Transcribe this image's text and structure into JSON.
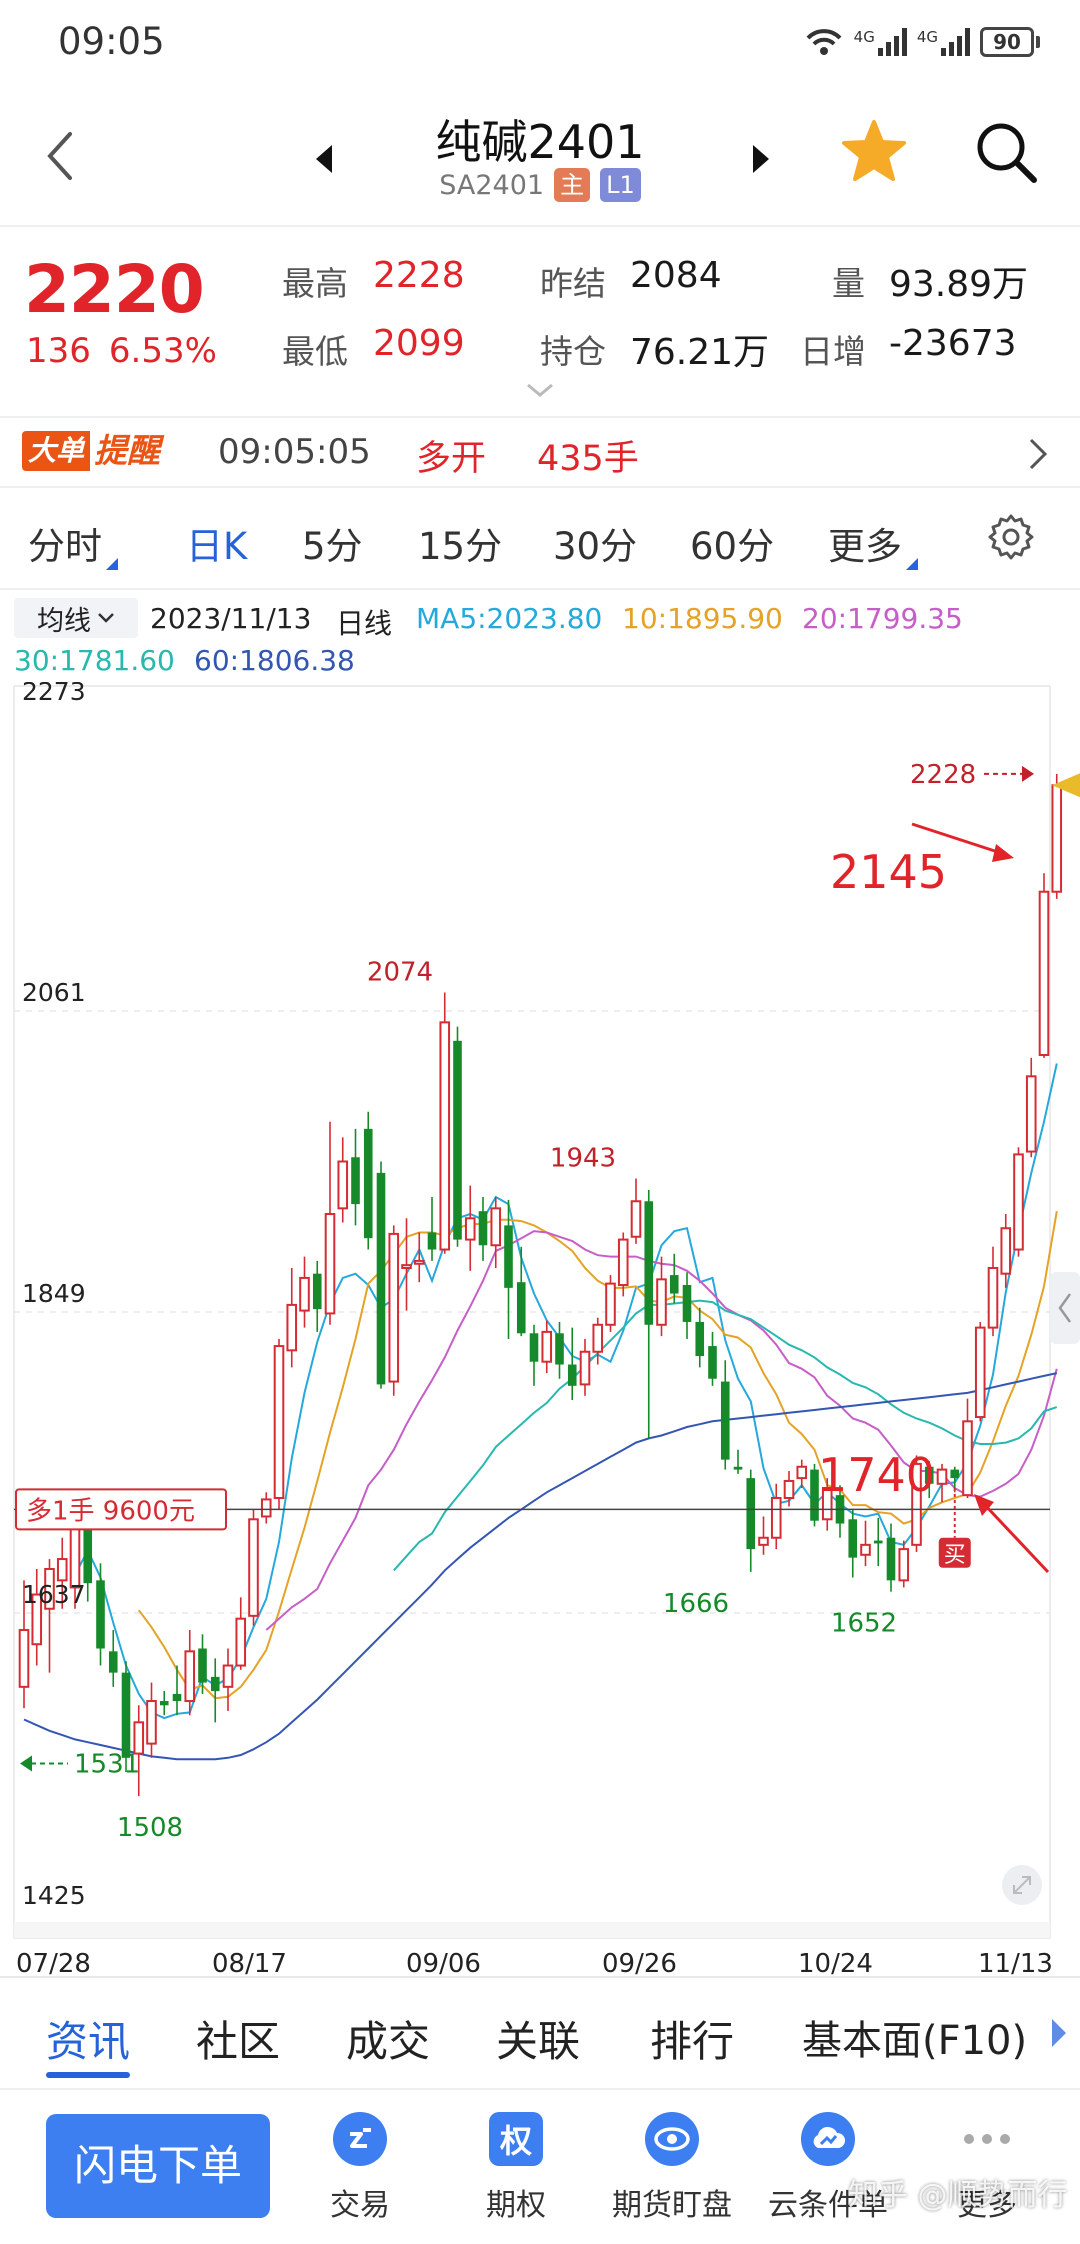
{
  "status_bar": {
    "time": "09:05",
    "net1": "4G",
    "net2": "4G",
    "battery": "90"
  },
  "header": {
    "title": "纯碱2401",
    "code": "SA2401",
    "tag_main": "主",
    "tag_level": "L1",
    "colors": {
      "tag_main": "#e27b56",
      "tag_level": "#7f8ad8",
      "star": "#f6ab28"
    }
  },
  "quote": {
    "last": "2220",
    "change": "136",
    "change_pct": "6.53%",
    "high_label": "最高",
    "high": "2228",
    "low_label": "最低",
    "low": "2099",
    "prev_settle_label": "昨结",
    "prev_settle": "2084",
    "oi_label": "持仓",
    "oi": "76.21万",
    "volume_label": "量",
    "volume": "93.89万",
    "daily_inc_label": "日增",
    "daily_inc": "-23673"
  },
  "alert": {
    "logo_a": "大单",
    "logo_b": "提醒",
    "time": "09:05:05",
    "type": "多开",
    "volume": "435手"
  },
  "period_tabs": [
    {
      "label": "分时",
      "active": false,
      "dropdown": true
    },
    {
      "label": "日K",
      "active": true,
      "dropdown": false
    },
    {
      "label": "5分",
      "active": false,
      "dropdown": false
    },
    {
      "label": "15分",
      "active": false,
      "dropdown": false
    },
    {
      "label": "30分",
      "active": false,
      "dropdown": false
    },
    {
      "label": "60分",
      "active": false,
      "dropdown": false
    },
    {
      "label": "更多",
      "active": false,
      "dropdown": true
    }
  ],
  "indicator": {
    "select": "均线",
    "date": "2023/11/13",
    "line_type": "日线",
    "ma": [
      {
        "text": "MA5:2023.80",
        "color": "#25a8dc"
      },
      {
        "text": "10:1895.90",
        "color": "#e5a227"
      },
      {
        "text": "20:1799.35",
        "color": "#c75ec8"
      },
      {
        "text": "30:1781.60",
        "color": "#28b8b0"
      },
      {
        "text": "60:1806.38",
        "color": "#3456b3"
      }
    ]
  },
  "chart_data": {
    "type": "candlestick",
    "y_ticks": [
      "2273",
      "2061",
      "1849",
      "1637",
      "1425"
    ],
    "ylim": [
      1425,
      2273
    ],
    "x_labels": [
      "07/28",
      "08/17",
      "09/06",
      "09/26",
      "10/24",
      "11/13"
    ],
    "candles": [
      {
        "o": 1585,
        "c": 1625,
        "h": 1660,
        "l": 1570
      },
      {
        "o": 1615,
        "c": 1650,
        "h": 1668,
        "l": 1600
      },
      {
        "o": 1640,
        "c": 1668,
        "h": 1675,
        "l": 1595
      },
      {
        "o": 1660,
        "c": 1675,
        "h": 1690,
        "l": 1640
      },
      {
        "o": 1655,
        "c": 1700,
        "h": 1712,
        "l": 1640
      },
      {
        "o": 1705,
        "c": 1658,
        "h": 1712,
        "l": 1645
      },
      {
        "o": 1660,
        "c": 1612,
        "h": 1672,
        "l": 1600
      },
      {
        "o": 1610,
        "c": 1595,
        "h": 1625,
        "l": 1585
      },
      {
        "o": 1595,
        "c": 1535,
        "h": 1603,
        "l": 1525
      },
      {
        "o": 1538,
        "c": 1560,
        "h": 1572,
        "l": 1508
      },
      {
        "o": 1545,
        "c": 1575,
        "h": 1588,
        "l": 1535
      },
      {
        "o": 1575,
        "c": 1572,
        "h": 1582,
        "l": 1565
      },
      {
        "o": 1580,
        "c": 1575,
        "h": 1600,
        "l": 1565
      },
      {
        "o": 1575,
        "c": 1610,
        "h": 1625,
        "l": 1565
      },
      {
        "o": 1612,
        "c": 1588,
        "h": 1622,
        "l": 1580
      },
      {
        "o": 1592,
        "c": 1582,
        "h": 1605,
        "l": 1560
      },
      {
        "o": 1585,
        "c": 1600,
        "h": 1612,
        "l": 1568
      },
      {
        "o": 1600,
        "c": 1633,
        "h": 1648,
        "l": 1597
      },
      {
        "o": 1635,
        "c": 1703,
        "h": 1710,
        "l": 1628
      },
      {
        "o": 1705,
        "c": 1717,
        "h": 1722,
        "l": 1700
      },
      {
        "o": 1718,
        "c": 1825,
        "h": 1830,
        "l": 1710
      },
      {
        "o": 1822,
        "c": 1854,
        "h": 1880,
        "l": 1810
      },
      {
        "o": 1850,
        "c": 1873,
        "h": 1888,
        "l": 1838
      },
      {
        "o": 1876,
        "c": 1851,
        "h": 1885,
        "l": 1835
      },
      {
        "o": 1848,
        "c": 1918,
        "h": 1983,
        "l": 1840
      },
      {
        "o": 1922,
        "c": 1955,
        "h": 1972,
        "l": 1912
      },
      {
        "o": 1958,
        "c": 1925,
        "h": 1978,
        "l": 1910
      },
      {
        "o": 1978,
        "c": 1901,
        "h": 1990,
        "l": 1893
      },
      {
        "o": 1947,
        "c": 1798,
        "h": 1955,
        "l": 1795
      },
      {
        "o": 1800,
        "c": 1904,
        "h": 1910,
        "l": 1790
      },
      {
        "o": 1880,
        "c": 1882,
        "h": 1915,
        "l": 1850
      },
      {
        "o": 1883,
        "c": 1885,
        "h": 1905,
        "l": 1870
      },
      {
        "o": 1905,
        "c": 1893,
        "h": 1930,
        "l": 1885
      },
      {
        "o": 1893,
        "c": 2053,
        "h": 2074,
        "l": 1890
      },
      {
        "o": 2040,
        "c": 1900,
        "h": 2050,
        "l": 1895
      },
      {
        "o": 1900,
        "c": 1915,
        "h": 1938,
        "l": 1878
      },
      {
        "o": 1920,
        "c": 1896,
        "h": 1930,
        "l": 1885
      },
      {
        "o": 1896,
        "c": 1922,
        "h": 1930,
        "l": 1880
      },
      {
        "o": 1910,
        "c": 1866,
        "h": 1928,
        "l": 1830
      },
      {
        "o": 1870,
        "c": 1834,
        "h": 1895,
        "l": 1832
      },
      {
        "o": 1834,
        "c": 1814,
        "h": 1840,
        "l": 1797
      },
      {
        "o": 1814,
        "c": 1835,
        "h": 1843,
        "l": 1806
      },
      {
        "o": 1834,
        "c": 1812,
        "h": 1842,
        "l": 1802
      },
      {
        "o": 1812,
        "c": 1797,
        "h": 1838,
        "l": 1787
      },
      {
        "o": 1798,
        "c": 1821,
        "h": 1830,
        "l": 1790
      },
      {
        "o": 1821,
        "c": 1840,
        "h": 1845,
        "l": 1812
      },
      {
        "o": 1840,
        "c": 1869,
        "h": 1875,
        "l": 1835
      },
      {
        "o": 1868,
        "c": 1900,
        "h": 1905,
        "l": 1860
      },
      {
        "o": 1902,
        "c": 1927,
        "h": 1943,
        "l": 1897
      },
      {
        "o": 1927,
        "c": 1840,
        "h": 1935,
        "l": 1760
      },
      {
        "o": 1840,
        "c": 1872,
        "h": 1888,
        "l": 1832
      },
      {
        "o": 1875,
        "c": 1862,
        "h": 1890,
        "l": 1855
      },
      {
        "o": 1868,
        "c": 1842,
        "h": 1877,
        "l": 1830
      },
      {
        "o": 1842,
        "c": 1818,
        "h": 1852,
        "l": 1810
      },
      {
        "o": 1825,
        "c": 1802,
        "h": 1835,
        "l": 1797
      },
      {
        "o": 1800,
        "c": 1745,
        "h": 1815,
        "l": 1738
      },
      {
        "o": 1740,
        "c": 1738,
        "h": 1752,
        "l": 1735
      },
      {
        "o": 1732,
        "c": 1682,
        "h": 1738,
        "l": 1666
      },
      {
        "o": 1685,
        "c": 1690,
        "h": 1705,
        "l": 1678
      },
      {
        "o": 1690,
        "c": 1718,
        "h": 1728,
        "l": 1682
      },
      {
        "o": 1718,
        "c": 1730,
        "h": 1737,
        "l": 1712
      },
      {
        "o": 1732,
        "c": 1740,
        "h": 1745,
        "l": 1725
      },
      {
        "o": 1738,
        "c": 1702,
        "h": 1742,
        "l": 1698
      },
      {
        "o": 1703,
        "c": 1725,
        "h": 1732,
        "l": 1695
      },
      {
        "o": 1720,
        "c": 1700,
        "h": 1727,
        "l": 1690
      },
      {
        "o": 1703,
        "c": 1676,
        "h": 1710,
        "l": 1662
      },
      {
        "o": 1678,
        "c": 1685,
        "h": 1702,
        "l": 1670
      },
      {
        "o": 1688,
        "c": 1686,
        "h": 1704,
        "l": 1670
      },
      {
        "o": 1690,
        "c": 1660,
        "h": 1700,
        "l": 1652
      },
      {
        "o": 1660,
        "c": 1682,
        "h": 1688,
        "l": 1655
      },
      {
        "o": 1685,
        "c": 1742,
        "h": 1748,
        "l": 1680
      },
      {
        "o": 1740,
        "c": 1728,
        "h": 1744,
        "l": 1718
      },
      {
        "o": 1728,
        "c": 1738,
        "h": 1742,
        "l": 1715
      },
      {
        "o": 1738,
        "c": 1732,
        "h": 1740,
        "l": 1722
      },
      {
        "o": 1720,
        "c": 1772,
        "h": 1788,
        "l": 1718
      },
      {
        "o": 1775,
        "c": 1838,
        "h": 1842,
        "l": 1772
      },
      {
        "o": 1838,
        "c": 1880,
        "h": 1895,
        "l": 1832
      },
      {
        "o": 1876,
        "c": 1908,
        "h": 1918,
        "l": 1866
      },
      {
        "o": 1893,
        "c": 1960,
        "h": 1965,
        "l": 1888
      },
      {
        "o": 1962,
        "c": 2015,
        "h": 2028,
        "l": 1958
      },
      {
        "o": 2030,
        "c": 2145,
        "h": 2158,
        "l": 2028
      },
      {
        "o": 2145,
        "c": 2220,
        "h": 2228,
        "l": 2140
      }
    ],
    "ma_series": [
      {
        "name": "MA5",
        "color": "#25a8dc",
        "values": [
          null,
          null,
          null,
          null,
          1664,
          1681,
          1662,
          1630,
          1600,
          1580,
          1567,
          1563,
          1566,
          1567,
          1592,
          1586,
          1591,
          1605,
          1627,
          1647,
          1687,
          1746,
          1792,
          1828,
          1855,
          1873,
          1876,
          1868,
          1852,
          1858,
          1876,
          1893,
          1871,
          1897,
          1915,
          1918,
          1914,
          1930,
          1925,
          1887,
          1862,
          1843,
          1831,
          1818,
          1814,
          1819,
          1814,
          1836,
          1866,
          1869,
          1896,
          1906,
          1908,
          1870,
          1873,
          1829,
          1802,
          1786,
          1739,
          1714,
          1716,
          1727,
          1714,
          1722,
          1714,
          1707,
          1705,
          1707,
          1687,
          1685,
          1697,
          1712,
          1728,
          1729,
          1743,
          1769,
          1805,
          1863,
          1906,
          1947,
          1983,
          2024
        ]
      },
      {
        "name": "MA10",
        "color": "#e5a227",
        "values": [
          null,
          null,
          null,
          null,
          null,
          null,
          null,
          null,
          null,
          1639,
          1627,
          1613,
          1597,
          1583,
          1586,
          1577,
          1578,
          1585,
          1597,
          1611,
          1638,
          1668,
          1697,
          1730,
          1764,
          1796,
          1830,
          1869,
          1878,
          1890,
          1902,
          1905,
          1905,
          1903,
          1908,
          1911,
          1911,
          1914,
          1914,
          1913,
          1910,
          1905,
          1899,
          1892,
          1880,
          1871,
          1866,
          1866,
          1867,
          1857,
          1856,
          1860,
          1859,
          1850,
          1844,
          1833,
          1831,
          1824,
          1806,
          1791,
          1771,
          1763,
          1752,
          1727,
          1724,
          1713,
          1713,
          1708,
          1707,
          1700,
          1703,
          1711,
          1715,
          1718,
          1721,
          1736,
          1758,
          1783,
          1804,
          1833,
          1867,
          1920
        ]
      },
      {
        "name": "MA20",
        "color": "#c75ec8",
        "values": [
          null,
          null,
          null,
          null,
          null,
          null,
          null,
          null,
          null,
          null,
          null,
          null,
          null,
          null,
          null,
          null,
          null,
          null,
          null,
          1625,
          1633,
          1641,
          1647,
          1654,
          1672,
          1688,
          1704,
          1727,
          1738,
          1752,
          1770,
          1786,
          1801,
          1817,
          1836,
          1853,
          1871,
          1892,
          1896,
          1901,
          1906,
          1905,
          1902,
          1899,
          1893,
          1889,
          1888,
          1888,
          1888,
          1885,
          1883,
          1882,
          1878,
          1871,
          1862,
          1852,
          1847,
          1843,
          1836,
          1826,
          1813,
          1809,
          1803,
          1790,
          1783,
          1774,
          1771,
          1766,
          1755,
          1743,
          1737,
          1737,
          1735,
          1725,
          1720,
          1719,
          1723,
          1728,
          1735,
          1752,
          1776,
          1809
        ]
      },
      {
        "name": "MA30",
        "color": "#28b8b0",
        "values": [
          null,
          null,
          null,
          null,
          null,
          null,
          null,
          null,
          null,
          null,
          null,
          null,
          null,
          null,
          null,
          null,
          null,
          null,
          null,
          null,
          null,
          null,
          null,
          null,
          null,
          null,
          null,
          null,
          null,
          1667,
          1677,
          1687,
          1693,
          1708,
          1719,
          1730,
          1741,
          1754,
          1762,
          1770,
          1778,
          1785,
          1795,
          1802,
          1811,
          1820,
          1829,
          1838,
          1848,
          1854,
          1854,
          1855,
          1856,
          1857,
          1856,
          1850,
          1847,
          1844,
          1838,
          1832,
          1826,
          1822,
          1817,
          1810,
          1805,
          1799,
          1796,
          1791,
          1784,
          1778,
          1774,
          1771,
          1767,
          1762,
          1758,
          1756,
          1756,
          1757,
          1760,
          1767,
          1779,
          1782
        ]
      },
      {
        "name": "MA60",
        "color": "#3456b3",
        "values": [
          1562,
          1558,
          1554,
          1551,
          1548,
          1546,
          1544,
          1542,
          1540,
          1538,
          1536,
          1535,
          1534,
          1534,
          1534,
          1534,
          1535,
          1537,
          1541,
          1546,
          1552,
          1560,
          1568,
          1576,
          1585,
          1594,
          1603,
          1612,
          1621,
          1630,
          1639,
          1648,
          1657,
          1667,
          1675,
          1683,
          1690,
          1697,
          1704,
          1710,
          1716,
          1722,
          1727,
          1732,
          1737,
          1742,
          1747,
          1752,
          1757,
          1760,
          1762,
          1765,
          1768,
          1770,
          1772,
          1773,
          1774,
          1775,
          1776,
          1777,
          1778,
          1779,
          1780,
          1781,
          1782,
          1783,
          1784,
          1785,
          1786,
          1787,
          1788,
          1789,
          1790,
          1791,
          1792,
          1794,
          1796,
          1798,
          1800,
          1802,
          1804,
          1806
        ]
      }
    ],
    "peak_labels": [
      "2074",
      "1943",
      "1666",
      "1652",
      "1508"
    ],
    "annotations": {
      "current_high": "2228",
      "big_price": "2145",
      "mid_price": "1740",
      "buy_marker": "买",
      "position_tag": "多1手  9600元",
      "position_level": 1710,
      "left_flag": "1531"
    }
  },
  "info_tabs": [
    "资讯",
    "社区",
    "成交",
    "关联",
    "排行",
    "基本面(F10)"
  ],
  "bottom_nav": {
    "flash_order": "闪电下单",
    "items": [
      {
        "label": "交易",
        "icon": "trade-icon"
      },
      {
        "label": "期权",
        "icon": "option-icon",
        "glyph": "权"
      },
      {
        "label": "期货盯盘",
        "icon": "watch-icon"
      },
      {
        "label": "云条件单",
        "icon": "cloud-order-icon"
      },
      {
        "label": "更多",
        "icon": "more-icon"
      }
    ],
    "watermark": "知乎 @顺势而行"
  },
  "colors": {
    "up": "#d52b32",
    "down": "#168a2a",
    "accent": "#2663d8"
  }
}
